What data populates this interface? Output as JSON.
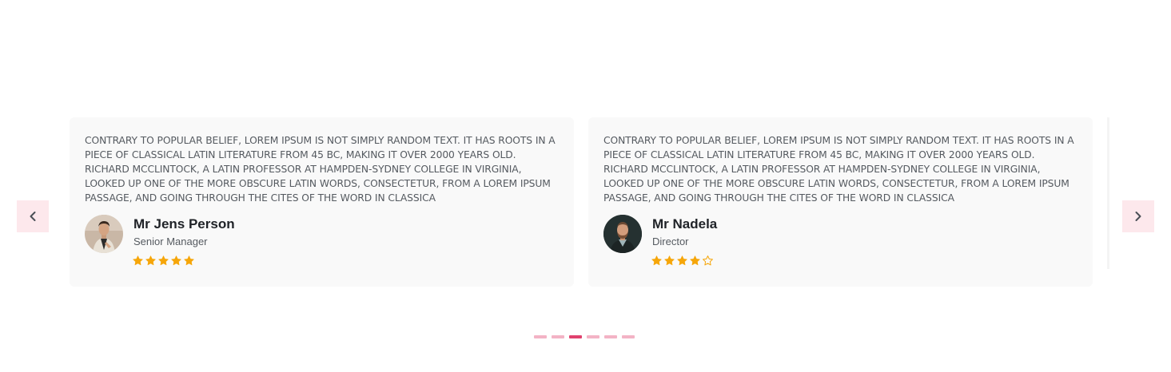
{
  "carousel": {
    "prev_icon": "chevron-left-icon",
    "next_icon": "chevron-right-icon",
    "accent_color": "#fde8ec",
    "star_color": "#f6a609",
    "dot_color": "#f3b3c5",
    "dot_active_color": "#e0416e",
    "dot_count": 6,
    "active_dot_index": 2
  },
  "testimonials": [
    {
      "quote": "CONTRARY TO POPULAR BELIEF, LOREM IPSUM IS NOT SIMPLY RANDOM TEXT. IT HAS ROOTS IN A PIECE OF CLASSICAL LATIN LITERATURE FROM 45 BC, MAKING IT OVER 2000 YEARS OLD. RICHARD MCCLINTOCK, A LATIN PROFESSOR AT HAMPDEN-SYDNEY COLLEGE IN VIRGINIA, LOOKED UP ONE OF THE MORE OBSCURE LATIN WORDS, CONSECTETUR, FROM A LOREM IPSUM PASSAGE, AND GOING THROUGH THE CITES OF THE WORD IN CLASSICA",
      "name": "Mr Jens Person",
      "role": "Senior Manager",
      "rating": 5,
      "rating_max": 5
    },
    {
      "quote": "CONTRARY TO POPULAR BELIEF, LOREM IPSUM IS NOT SIMPLY RANDOM TEXT. IT HAS ROOTS IN A PIECE OF CLASSICAL LATIN LITERATURE FROM 45 BC, MAKING IT OVER 2000 YEARS OLD. RICHARD MCCLINTOCK, A LATIN PROFESSOR AT HAMPDEN-SYDNEY COLLEGE IN VIRGINIA, LOOKED UP ONE OF THE MORE OBSCURE LATIN WORDS, CONSECTETUR, FROM A LOREM IPSUM PASSAGE, AND GOING THROUGH THE CITES OF THE WORD IN CLASSICA",
      "name": "Mr Nadela",
      "role": "Director",
      "rating": 4,
      "rating_max": 5
    }
  ]
}
